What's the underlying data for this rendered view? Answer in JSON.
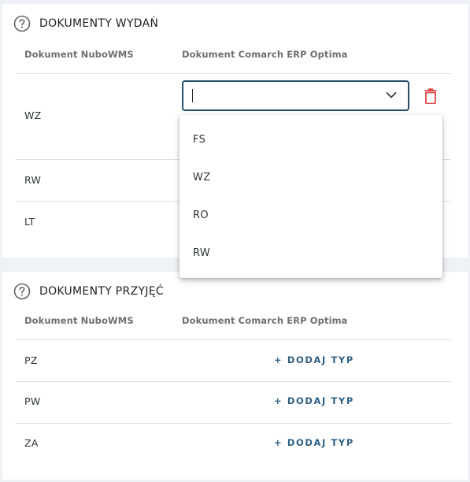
{
  "issue_section": {
    "title": "DOKUMENTY WYDAŃ",
    "col_nubo": "Dokument NuboWMS",
    "col_erp": "Dokument Comarch ERP Optima",
    "rows": [
      {
        "label": "WZ"
      },
      {
        "label": "RW"
      },
      {
        "label": "LT"
      }
    ],
    "select": {
      "value": "",
      "placeholder": ""
    },
    "dropdown_options": [
      "FS",
      "WZ",
      "RO",
      "RW"
    ]
  },
  "receipt_section": {
    "title": "DOKUMENTY PRZYJĘĆ",
    "col_nubo": "Dokument NuboWMS",
    "col_erp": "Dokument Comarch ERP Optima",
    "rows": [
      {
        "label": "PZ",
        "action": "+ DODAJ TYP"
      },
      {
        "label": "PW",
        "action": "+ DODAJ TYP"
      },
      {
        "label": "ZA",
        "action": "+ DODAJ TYP"
      }
    ]
  },
  "icons": {
    "help": "help-circle-icon",
    "delete": "trash-icon",
    "chevron": "chevron-down-icon"
  },
  "colors": {
    "accent": "#244d6b",
    "link": "#2e5f85",
    "delete": "#e0454a",
    "background": "#eef1f5"
  }
}
